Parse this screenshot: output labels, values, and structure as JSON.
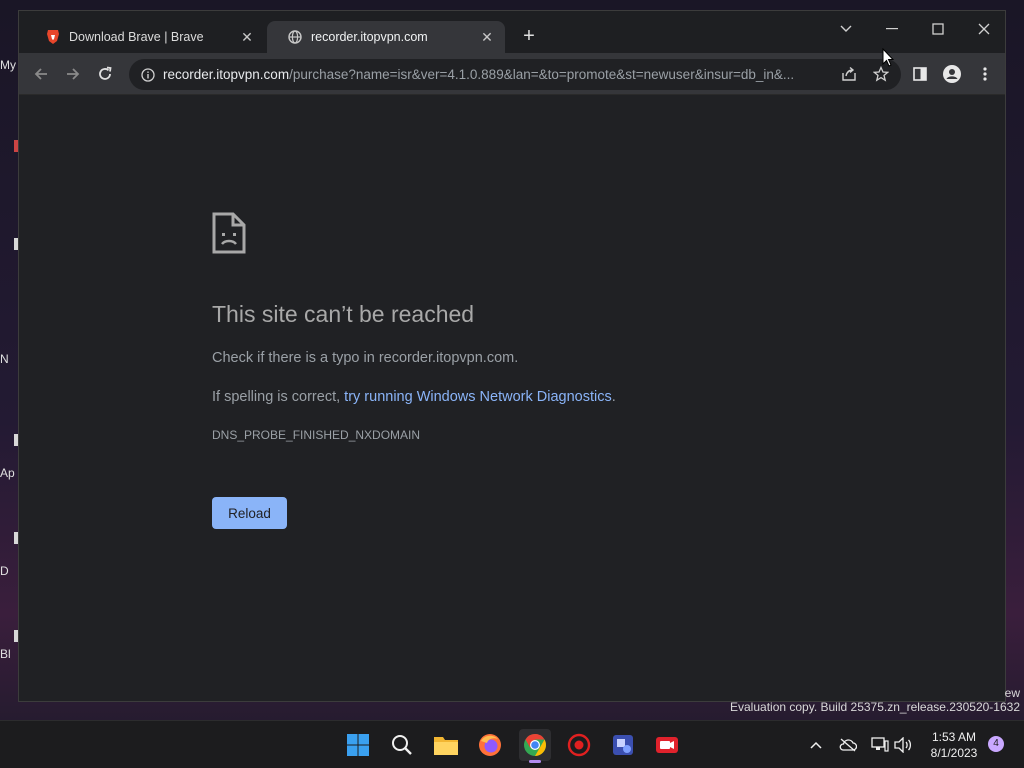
{
  "desktop": {
    "labels": [
      "My",
      "N",
      "Ap",
      "D",
      "Bl"
    ]
  },
  "tabs": [
    {
      "title": "Download Brave | Brave",
      "icon": "brave-lion-icon",
      "active": false
    },
    {
      "title": "recorder.itopvpn.com",
      "icon": "globe-icon",
      "active": true
    }
  ],
  "address_bar": {
    "host": "recorder.itopvpn.com",
    "path": "/purchase?name=isr&ver=4.1.0.889&lan=&to=promote&st=newuser&insur=db_in&..."
  },
  "error_page": {
    "title": "This site can’t be reached",
    "line1": "Check if there is a typo in recorder.itopvpn.com.",
    "line2_prefix": "If spelling is correct, ",
    "line2_link": "try running Windows Network Diagnostics",
    "line2_suffix": ".",
    "code": "DNS_PROBE_FINISHED_NXDOMAIN",
    "reload_label": "Reload"
  },
  "watermark": {
    "top_fragment": "ew",
    "text": "Evaluation copy. Build 25375.zn_release.230520-1632"
  },
  "taskbar": {
    "apps": [
      "windows-start-icon",
      "search-icon",
      "file-explorer-icon",
      "firefox-icon",
      "chrome-icon",
      "settings-bug-icon",
      "app-blue-icon",
      "recorder-icon"
    ],
    "time": "1:53 AM",
    "date": "8/1/2023",
    "notification_count": "4"
  },
  "colors": {
    "page_bg": "#202124",
    "link": "#8ab4f8",
    "button": "#8ab4f8",
    "tab_active": "#35363a"
  }
}
